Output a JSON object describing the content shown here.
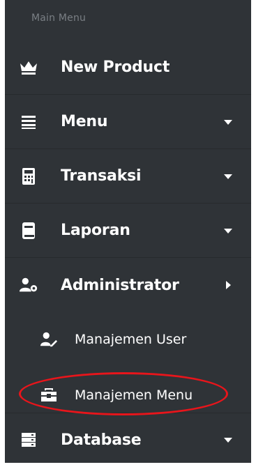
{
  "sidebar": {
    "section_label": "Main Menu",
    "items": [
      {
        "label": "New Product",
        "icon": "crown-icon",
        "caret": "none"
      },
      {
        "label": "Menu",
        "icon": "list-icon",
        "caret": "down"
      },
      {
        "label": "Transaksi",
        "icon": "calculator-icon",
        "caret": "down"
      },
      {
        "label": "Laporan",
        "icon": "book-icon",
        "caret": "down"
      },
      {
        "label": "Administrator",
        "icon": "users-cog-icon",
        "caret": "right"
      },
      {
        "label": "Database",
        "icon": "database-icon",
        "caret": "down"
      }
    ],
    "submenu": [
      {
        "label": "Manajemen User",
        "icon": "user-edit-icon"
      },
      {
        "label": "Manajemen Menu",
        "icon": "toolbox-icon",
        "highlighted": true
      }
    ]
  },
  "colors": {
    "sidebar_bg": "#2f3337",
    "text": "#ffffff",
    "section_label": "#7a7f84",
    "highlight_ring": "#e8151b"
  }
}
